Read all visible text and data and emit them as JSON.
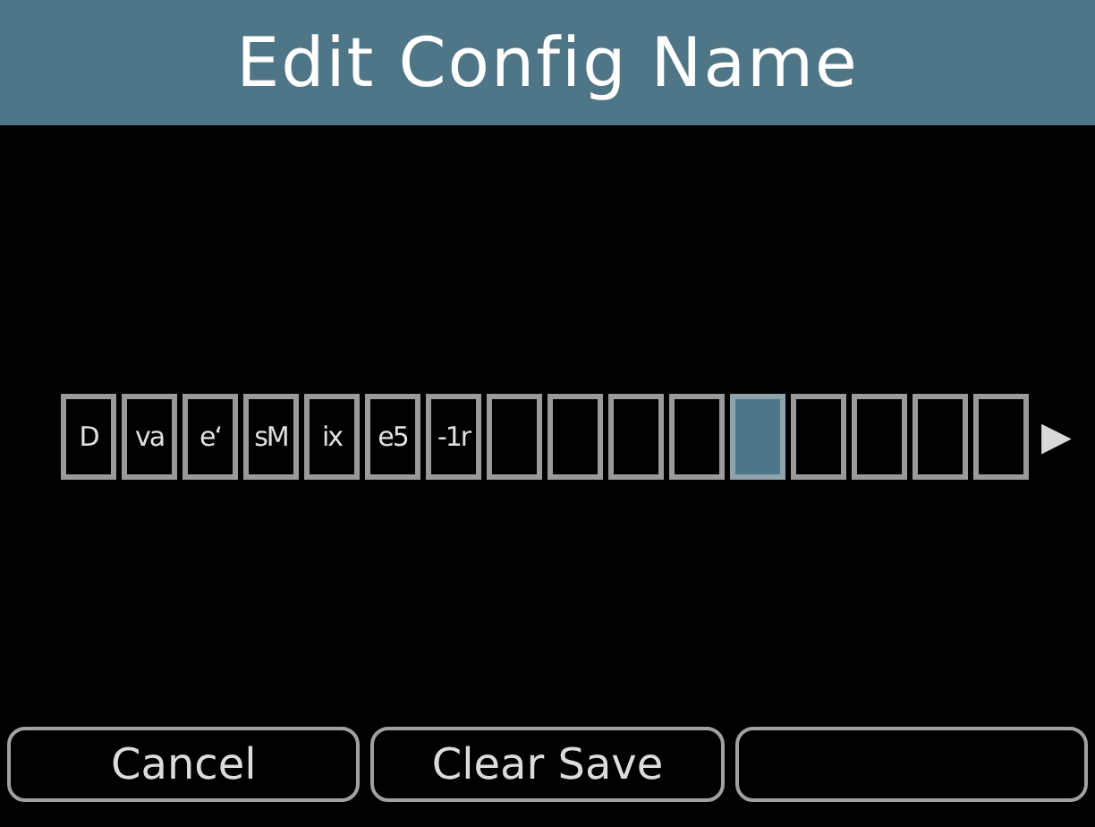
{
  "title": "Edit Config Name",
  "cells": [
    {
      "char": "D",
      "selected": false
    },
    {
      "char": "va",
      "selected": false
    },
    {
      "char": "e‘",
      "selected": false
    },
    {
      "char": "sM",
      "selected": false
    },
    {
      "char": "ix",
      "selected": false
    },
    {
      "char": "e5",
      "selected": false
    },
    {
      "char": "-1r",
      "selected": false
    },
    {
      "selected": false
    },
    {
      "selected": false
    },
    {
      "selected": false
    },
    {
      "selected": false
    },
    {
      "selected": true
    },
    {
      "selected": false
    },
    {
      "selected": false
    },
    {
      "selected": false
    },
    {
      "selected": false
    }
  ],
  "next_arrow": "▶",
  "softkeys": [
    "Cancel",
    "Clear Save"
  ]
}
